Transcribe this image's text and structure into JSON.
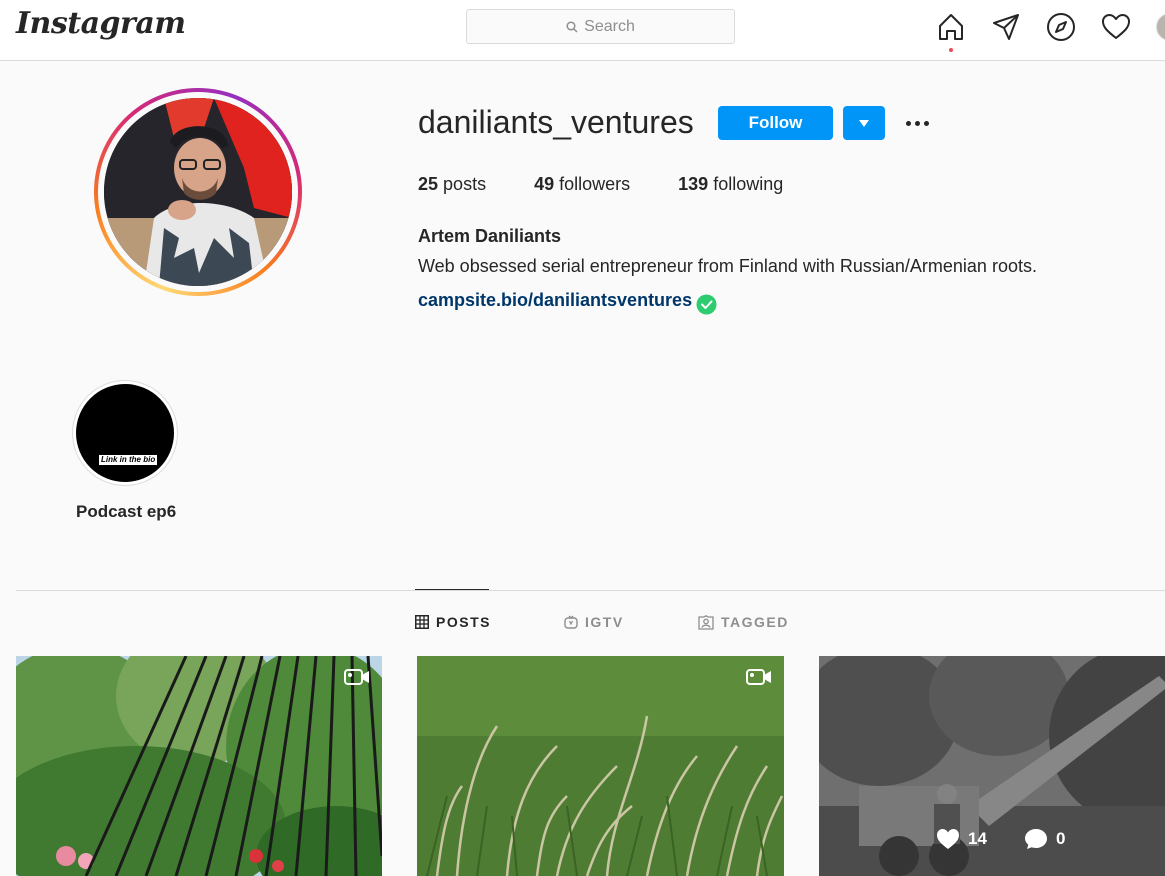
{
  "header": {
    "logo": "Instagram",
    "search_placeholder": "Search"
  },
  "nav": [
    "home-icon",
    "direct-icon",
    "explore-icon",
    "activity-icon",
    "profile-avatar"
  ],
  "profile": {
    "username": "daniliants_ventures",
    "follow_label": "Follow",
    "stats": [
      {
        "count": "25",
        "label": "posts"
      },
      {
        "count": "49",
        "label": "followers"
      },
      {
        "count": "139",
        "label": "following"
      }
    ],
    "full_name": "Artem Daniliants",
    "bio": "Web obsessed serial entrepreneur from Finland with Russian/Armenian roots.",
    "link": "campsite.bio/daniliantsventures"
  },
  "highlights": [
    {
      "label": "Podcast ep6",
      "image_text": "Link in the bio"
    }
  ],
  "tabs": [
    {
      "label": "POSTS",
      "icon": "grid-icon",
      "active": true
    },
    {
      "label": "IGTV",
      "icon": "igtv-icon",
      "active": false
    },
    {
      "label": "TAGGED",
      "icon": "tagged-icon",
      "active": false
    }
  ],
  "posts": [
    {
      "type": "video",
      "description": "black-strings-on-greenery"
    },
    {
      "type": "video",
      "description": "tall-grass"
    },
    {
      "type": "photo",
      "likes": "14",
      "comments": "0"
    }
  ],
  "colors": {
    "accent": "#0095f6",
    "link": "#00376b",
    "notification": "#ed4956",
    "verified": "#2ecc71"
  }
}
